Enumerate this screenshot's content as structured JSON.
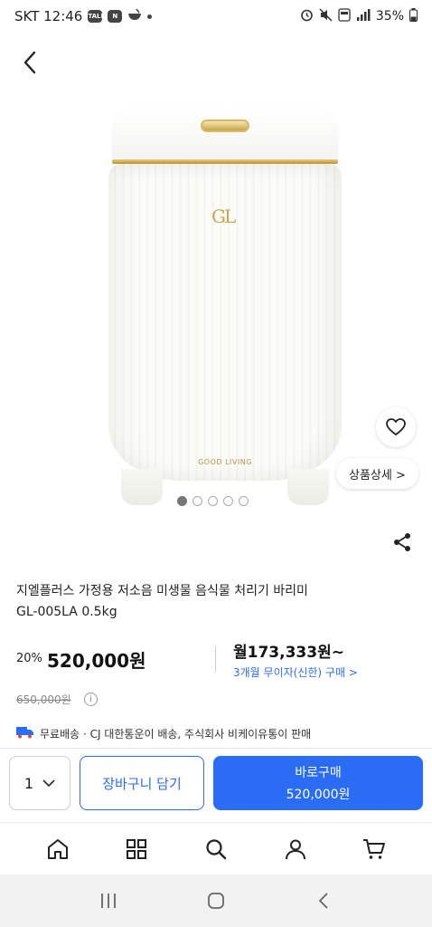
{
  "status_bar": {
    "carrier_time": "SKT 12:46",
    "battery": "35%",
    "icons": [
      "talk-icon",
      "news-icon",
      "bowl-icon",
      "alarm-icon",
      "mute-icon",
      "volte-icon",
      "signal-icon",
      "battery-icon"
    ]
  },
  "product": {
    "detail_button_label": "상품상세 >",
    "pager": {
      "total": 5,
      "current": 1
    },
    "bin_brand": "GOOD LIVING",
    "title_line1": "지엘플러스 가정용 저소음 미생물 음식물 처리기 바리미",
    "title_line2": "GL-005LA 0.5kg"
  },
  "pricing": {
    "discount_rate": "20%",
    "sale_price": "520,000원",
    "monthly": "월173,333원~",
    "installment_link": "3개월 무이자(신한) 구매 >",
    "original_price": "650,000원",
    "info_icon": "i"
  },
  "shipping": {
    "text": "무료배송 · CJ 대한통운이 배송, 주식회사 비케이유통이 판매"
  },
  "purchase_bar": {
    "quantity": "1",
    "cart_label": "장바구니 담기",
    "buy_label": "바로구매",
    "buy_price": "520,000원"
  },
  "tab_bar": [
    "home-icon",
    "category-icon",
    "search-icon",
    "my-page-icon",
    "cart-icon"
  ],
  "colors": {
    "accent": "#2a6df4",
    "gold": "#c6a552"
  }
}
